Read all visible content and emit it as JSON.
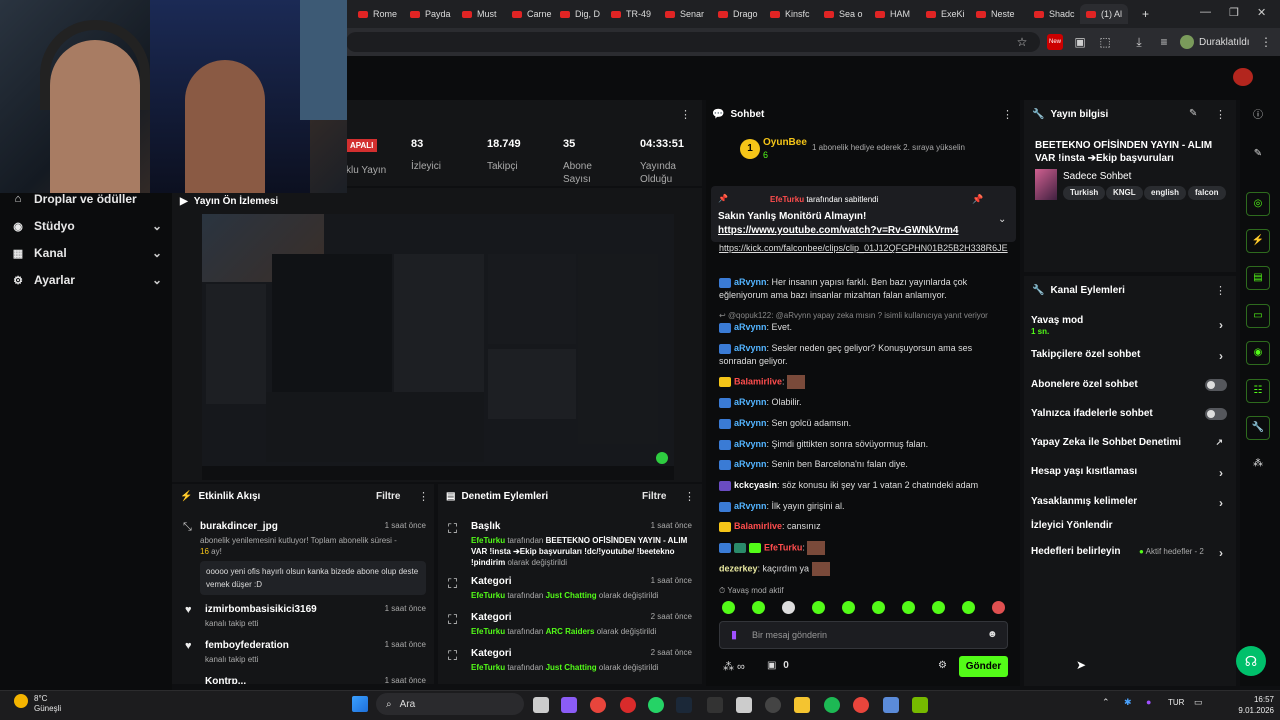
{
  "browser": {
    "tabs": [
      "Rome",
      "Payda",
      "Must",
      "Carne",
      "Dig, D",
      "TR-49",
      "Senar",
      "Drago",
      "Kinsfc",
      "Sea o",
      "HAM",
      "ExeKi",
      "Neste",
      "Shadc",
      "(1) Al"
    ],
    "new_tab": "+",
    "profile_label": "Duraklatıldı",
    "new_badge": "New"
  },
  "leftnav": {
    "items": [
      {
        "label": "Droplar ve ödüller",
        "icon": "gift-icon"
      },
      {
        "label": "Stüdyo",
        "icon": "studio-icon"
      },
      {
        "label": "Kanal",
        "icon": "channel-icon"
      },
      {
        "label": "Ayarlar",
        "icon": "gear-icon"
      }
    ]
  },
  "stats": {
    "badge": "APALI",
    "label_partial": "klu Yayın",
    "items": [
      {
        "value": "83",
        "label": "İzleyici"
      },
      {
        "value": "18.749",
        "label": "Takipçi"
      },
      {
        "value": "35",
        "label": "Abone Sayısı"
      },
      {
        "value": "04:33:51",
        "label": "Yayında Olduğu"
      }
    ]
  },
  "preview": {
    "title": "Yayın Ön İzlemesi"
  },
  "activity": {
    "title": "Etkinlik Akışı",
    "filter": "Filtre",
    "items": [
      {
        "name": "burakdincer_jpg",
        "time": "1 saat önce",
        "desc": "abonelik yenilemesini kutluyor! Toplam abonelik süresi -",
        "months": "16",
        "months_suffix": "ay!",
        "message": "ooooo yeni ofis hayırlı olsun kanka bizede abone olup deste vemek düşer :D"
      },
      {
        "name": "izmirbombasisikici3169",
        "time": "1 saat önce",
        "desc": "kanalı takip etti"
      },
      {
        "name": "femboyfederation",
        "time": "1 saat önce",
        "desc": "kanalı takip etti"
      },
      {
        "name": "Kontrp...",
        "time": "1 saat önce",
        "desc": ""
      }
    ]
  },
  "modlog": {
    "title": "Denetim Eylemleri",
    "filter": "Filtre",
    "items": [
      {
        "title": "Başlık",
        "time": "1 saat önce",
        "user": "EfeTurku",
        "mid": "tarafından",
        "value": "BEETEKNO OFİSİNDEN YAYIN - ALIM VAR !insta ➔Ekip başvuruları !dc/!youtube/ !beetekno !pindirim",
        "end": "olarak değiştirildi"
      },
      {
        "title": "Kategori",
        "time": "1 saat önce",
        "user": "EfeTurku",
        "mid": "tarafından",
        "value": "Just Chatting",
        "end": "olarak değiştirildi"
      },
      {
        "title": "Kategori",
        "time": "2 saat önce",
        "user": "EfeTurku",
        "mid": "tarafından",
        "value": "ARC Raiders",
        "end": "olarak değiştirildi"
      },
      {
        "title": "Kategori",
        "time": "2 saat önce",
        "user": "EfeTurku",
        "mid": "tarafından",
        "value": "Just Chatting",
        "end": "olarak değiştirildi"
      }
    ]
  },
  "chat": {
    "title": "Sohbet",
    "top_user": "OyunBee",
    "top_rank": "1",
    "top_count": "6",
    "top_msg": "1 abonelik hediye ederek 2. sıraya yükselin",
    "pinned_by_user": "EfeTurku",
    "pinned_by": "tarafından sabitlendi",
    "pinned_text": "Sakın Yanlış Monitörü Almayın!",
    "pinned_link": "https://www.youtube.com/watch?v=Rv-GWNkVrm4",
    "link_line": "https://kick.com/falconbee/clips/clip_01J12QFGPHN01B25B2H338R6JE",
    "lines": [
      {
        "user": "aRvynn",
        "text": "Her insanın yapısı farklı. Ben bazı yayınlarda çok eğleniyorum ama bazı insanlar mizahtan falan anlamıyor."
      },
      {
        "reply": "@qopuk122: @aRvynn yapay zeka mısın ? isimli kullanıcıya yanıt veriyor"
      },
      {
        "user": "aRvynn",
        "text": "Evet."
      },
      {
        "user": "aRvynn",
        "text": "Sesler neden geç geliyor? Konuşuyorsun ama ses sonradan geliyor."
      },
      {
        "user": "Balamirlive",
        "text": ""
      },
      {
        "user": "aRvynn",
        "text": "Olabilir."
      },
      {
        "user": "aRvynn",
        "text": "Sen golcü adamsın."
      },
      {
        "user": "aRvynn",
        "text": "Şimdi gittikten sonra sövüyormuş falan."
      },
      {
        "user": "aRvynn",
        "text": "Senin ben Barcelona'nı falan diye."
      },
      {
        "user": "kckcyasin",
        "text": "söz konusu iki şey var 1 vatan 2 chatındeki adam"
      },
      {
        "user": "aRvynn",
        "text": "İlk yayın girişini al."
      },
      {
        "user": "Balamirlive",
        "text": "cansınız"
      },
      {
        "user": "EfeTurku",
        "text": ""
      },
      {
        "user": "dezerkey",
        "text": "kaçırdım ya"
      }
    ],
    "slow_mode": "Yavaş mod aktif",
    "input_placeholder": "Bir mesaj gönderin",
    "gift_count": "0",
    "send": "Gönder"
  },
  "streaminfo": {
    "title": "Yayın bilgisi",
    "stream_title": "BEETEKNO OFİSİNDEN YAYIN - ALIM VAR !insta ➔Ekip başvuruları !dc/!youtube/...",
    "category": "Sadece Sohbet",
    "tags": [
      "Turkish",
      "KNGL",
      "english",
      "falcon"
    ]
  },
  "channel_actions": {
    "title": "Kanal Eylemleri",
    "slow_mode": "Yavaş mod",
    "slow_value": "1 sn.",
    "followers_only": "Takipçilere özel sohbet",
    "subs_only": "Abonelere özel sohbet",
    "emotes_only": "Yalnızca ifadelerle sohbet",
    "ai_mod": "Yapay Zeka ile Sohbet Denetimi",
    "age_limit": "Hesap yaşı kısıtlaması",
    "banned_words": "Yasaklanmış kelimeler",
    "raid": "İzleyici Yönlendir",
    "goals": "Hedefleri belirleyin",
    "goals_status": "Aktif hedefler - 2"
  },
  "taskbar": {
    "weather_temp": "8°C",
    "weather_desc": "Güneşli",
    "search": "Ara",
    "lang": "TUR",
    "time": "16:57",
    "date": "9.01.2026"
  },
  "colors": {
    "accent": "#53fc18",
    "live": "#d32f2f",
    "bg": "#0e0f11"
  }
}
